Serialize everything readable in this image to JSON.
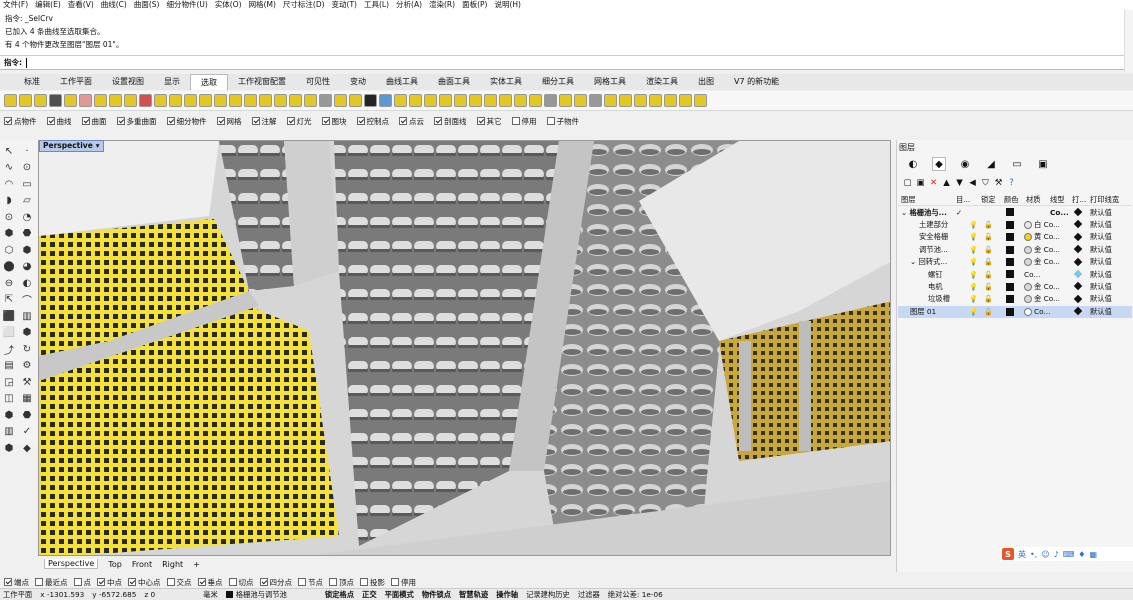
{
  "menu": [
    "文件(F)",
    "编辑(E)",
    "查看(V)",
    "曲线(C)",
    "曲面(S)",
    "细分物件(U)",
    "实体(O)",
    "网格(M)",
    "尺寸标注(D)",
    "变动(T)",
    "工具(L)",
    "分析(A)",
    "渲染(R)",
    "面板(P)",
    "说明(H)"
  ],
  "command": {
    "history": [
      "指令: _SelCrv",
      "已加入 4 条曲线至选取集合。",
      "有 4 个物件更改至图层\"图层 01\"。"
    ],
    "prompt": "指令:"
  },
  "tabs": [
    "标准",
    "工作平面",
    "设置视图",
    "显示",
    "选取",
    "工作视窗配置",
    "可见性",
    "变动",
    "曲线工具",
    "曲面工具",
    "实体工具",
    "细分工具",
    "网格工具",
    "渲染工具",
    "出图",
    "V7 的新功能"
  ],
  "active_tab": "选取",
  "filters": [
    {
      "label": "点物件",
      "checked": true
    },
    {
      "label": "曲线",
      "checked": true
    },
    {
      "label": "曲面",
      "checked": true
    },
    {
      "label": "多重曲面",
      "checked": true
    },
    {
      "label": "细分物件",
      "checked": true
    },
    {
      "label": "网格",
      "checked": true
    },
    {
      "label": "注解",
      "checked": true
    },
    {
      "label": "灯光",
      "checked": true
    },
    {
      "label": "图块",
      "checked": true
    },
    {
      "label": "控制点",
      "checked": true
    },
    {
      "label": "点云",
      "checked": true
    },
    {
      "label": "剖面线",
      "checked": true
    },
    {
      "label": "其它",
      "checked": true
    },
    {
      "label": "停用",
      "checked": false
    },
    {
      "label": "子物件",
      "checked": false
    }
  ],
  "viewport": {
    "name": "Perspective",
    "view_tabs": [
      "Perspective",
      "Top",
      "Front",
      "Right"
    ]
  },
  "layers_panel": {
    "title": "图层",
    "headers": {
      "name": "图层",
      "current": "目...",
      "lock": "锁定",
      "color": "颜色",
      "material": "材质",
      "linetype": "线型",
      "print": "打...",
      "print_width": "打印线宽"
    },
    "rows": [
      {
        "name": "格栅池与...",
        "current": "✓",
        "light": false,
        "lock": false,
        "mat": "",
        "mat_color": "",
        "linetype": "Co...",
        "pw": "默认值",
        "indent": 0,
        "expand": "⌄",
        "bold": true,
        "selected": false
      },
      {
        "name": "土建部分",
        "current": "",
        "light": true,
        "lock": true,
        "mat": "白 Co...",
        "mat_color": "#e8e8e8",
        "linetype": "",
        "pw": "默认值",
        "indent": 1,
        "expand": "",
        "bold": false,
        "selected": false
      },
      {
        "name": "安全格栅",
        "current": "",
        "light": true,
        "lock": true,
        "mat": "黄 Co...",
        "mat_color": "#f2d21c",
        "linetype": "",
        "pw": "默认值",
        "indent": 1,
        "expand": "",
        "bold": false,
        "selected": false
      },
      {
        "name": "调节池...",
        "current": "",
        "light": true,
        "lock": true,
        "mat": "金 Co...",
        "mat_color": "#d8d8d8",
        "linetype": "",
        "pw": "默认值",
        "indent": 1,
        "expand": "",
        "bold": false,
        "selected": false
      },
      {
        "name": "回转式...",
        "current": "",
        "light": true,
        "lock": true,
        "mat": "金 Co...",
        "mat_color": "#d8d8d8",
        "linetype": "",
        "pw": "默认值",
        "indent": 1,
        "expand": "⌄",
        "bold": false,
        "selected": false
      },
      {
        "name": "螺钉",
        "current": "",
        "light": true,
        "lock": true,
        "mat": "Co...",
        "mat_color": "",
        "linetype": "",
        "pw": "默认值",
        "indent": 2,
        "expand": "",
        "bold": false,
        "selected": false,
        "print_light": true
      },
      {
        "name": "电机",
        "current": "",
        "light": true,
        "lock": true,
        "mat": "金 Co...",
        "mat_color": "#d8d8d8",
        "linetype": "",
        "pw": "默认值",
        "indent": 2,
        "expand": "",
        "bold": false,
        "selected": false
      },
      {
        "name": "垃圾槽",
        "current": "",
        "light": true,
        "lock": true,
        "mat": "金 Co...",
        "mat_color": "#d8d8d8",
        "linetype": "",
        "pw": "默认值",
        "indent": 2,
        "expand": "",
        "bold": false,
        "selected": false
      },
      {
        "name": "图层 01",
        "current": "",
        "light": true,
        "lock": true,
        "mat": "Co...",
        "mat_color": "#ffffff",
        "linetype": "",
        "pw": "默认值",
        "indent": 0,
        "expand": "",
        "bold": false,
        "selected": true
      }
    ]
  },
  "osnaps": [
    {
      "label": "端点",
      "checked": true
    },
    {
      "label": "最近点",
      "checked": false
    },
    {
      "label": "点",
      "checked": false
    },
    {
      "label": "中点",
      "checked": true
    },
    {
      "label": "中心点",
      "checked": true
    },
    {
      "label": "交点",
      "checked": false
    },
    {
      "label": "垂点",
      "checked": true
    },
    {
      "label": "切点",
      "checked": false
    },
    {
      "label": "四分点",
      "checked": true
    },
    {
      "label": "节点",
      "checked": false
    },
    {
      "label": "顶点",
      "checked": false
    },
    {
      "label": "投影",
      "checked": false
    },
    {
      "label": "停用",
      "checked": false
    }
  ],
  "status": {
    "plane": "工作平面",
    "x": "x -1301.593",
    "y": "y -6572.685",
    "z": "z 0",
    "unit": "毫米",
    "layer": "格栅池与调节池",
    "toggles": [
      "锁定格点",
      "正交",
      "平面模式",
      "物件锁点",
      "智慧轨迹",
      "操作轴"
    ],
    "extra": [
      "记录建构历史",
      "过滤器",
      "绝对公差: 1e-06"
    ]
  },
  "ime": {
    "logo": "S",
    "lang": "英"
  }
}
